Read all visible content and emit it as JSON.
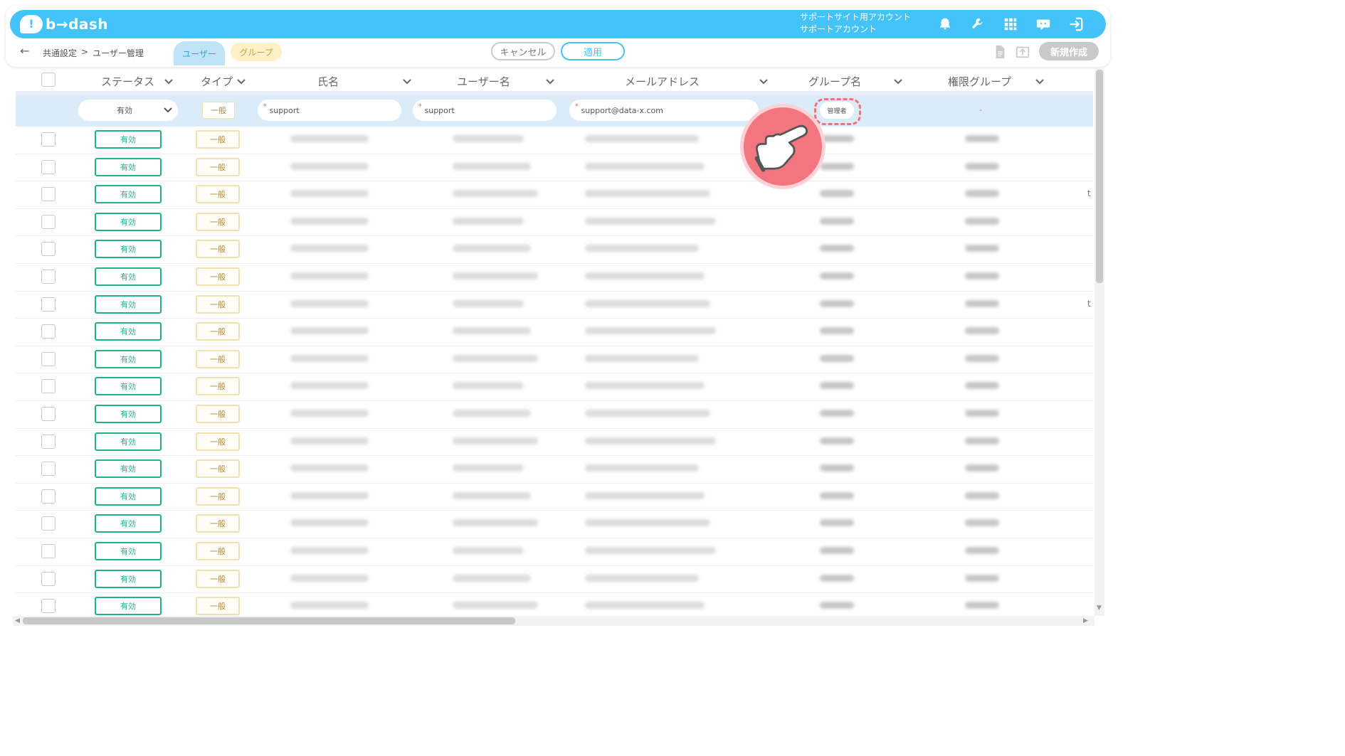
{
  "app": {
    "logo_mark": "!",
    "logo_text": "b→dash"
  },
  "account": {
    "line1": "サポートサイト用アカウント",
    "line2": "サポートアカウント"
  },
  "header_icons": [
    "bell-icon",
    "wrench-icon",
    "grid-icon",
    "chat-icon",
    "logout-icon"
  ],
  "nav": {
    "back": "←",
    "breadcrumb": [
      "共通設定",
      ">",
      "ユーザー管理"
    ],
    "tabs": [
      {
        "label": "ユーザー",
        "active": true
      },
      {
        "label": "グループ",
        "active": false
      }
    ]
  },
  "actions": {
    "cancel": "キャンセル",
    "apply": "適用",
    "new": "新規作成"
  },
  "columns": [
    "ステータス",
    "タイプ",
    "氏名",
    "ユーザー名",
    "メールアドレス",
    "グループ名",
    "権限グループ"
  ],
  "filter": {
    "status": "有効",
    "type": "一般",
    "name": "support",
    "username": "support",
    "email": "support@data-x.com",
    "group": "管理者",
    "permission": "-"
  },
  "rows": [
    {
      "status": "有効",
      "type": "一般"
    },
    {
      "status": "有効",
      "type": "一般"
    },
    {
      "status": "有効",
      "type": "一般"
    },
    {
      "status": "有効",
      "type": "一般"
    },
    {
      "status": "有効",
      "type": "一般"
    },
    {
      "status": "有効",
      "type": "一般"
    },
    {
      "status": "有効",
      "type": "一般"
    },
    {
      "status": "有効",
      "type": "一般"
    },
    {
      "status": "有効",
      "type": "一般"
    },
    {
      "status": "有効",
      "type": "一般"
    },
    {
      "status": "有効",
      "type": "一般"
    },
    {
      "status": "有効",
      "type": "一般"
    },
    {
      "status": "有効",
      "type": "一般"
    },
    {
      "status": "有効",
      "type": "一般"
    },
    {
      "status": "有効",
      "type": "一般"
    },
    {
      "status": "有効",
      "type": "一般"
    },
    {
      "status": "有効",
      "type": "一般"
    },
    {
      "status": "有効",
      "type": "一般"
    }
  ],
  "edge_text": "t",
  "colors": {
    "primary": "#43c3f7",
    "status_green": "#22b28a",
    "type_gold": "#f4e1b1",
    "pointer": "#f27580"
  }
}
